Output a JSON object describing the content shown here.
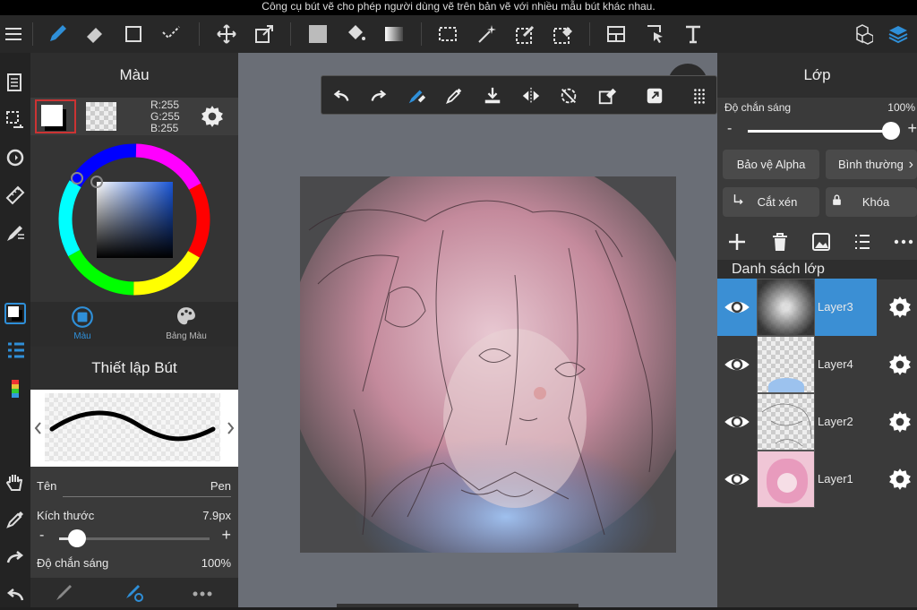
{
  "tooltip": "Công cụ bút vẽ cho phép người dùng vẽ trên bản vẽ với nhiều mẫu bút khác nhau.",
  "color_panel": {
    "title": "Màu",
    "rgb": {
      "r": "R:255",
      "g": "G:255",
      "b": "B:255"
    },
    "tabs": [
      "Màu",
      "Bảng Màu"
    ],
    "accent": "#2f8fd8"
  },
  "pen_panel": {
    "title": "Thiết lập Bút",
    "name_label": "Tên",
    "name_value": "Pen",
    "size_label": "Kích thước",
    "size_value": "7.9px",
    "size_level": 0.12,
    "opacity_label": "Độ chắn sáng",
    "opacity_value": "100%"
  },
  "layer_panel": {
    "title": "Lớp",
    "opacity_label": "Độ chắn sáng",
    "opacity_value": "100%",
    "opacity_level": 1.0,
    "alpha_protect": "Bảo vệ Alpha",
    "blend_mode": "Bình thường",
    "clip": "Cắt xén",
    "lock": "Khóa",
    "list_title": "Danh sách lớp",
    "layers": [
      {
        "name": "Layer3",
        "selected": true
      },
      {
        "name": "Layer4",
        "selected": false
      },
      {
        "name": "Layer2",
        "selected": false
      },
      {
        "name": "Layer1",
        "selected": false
      }
    ],
    "selected_color": "#3b8fd4"
  }
}
